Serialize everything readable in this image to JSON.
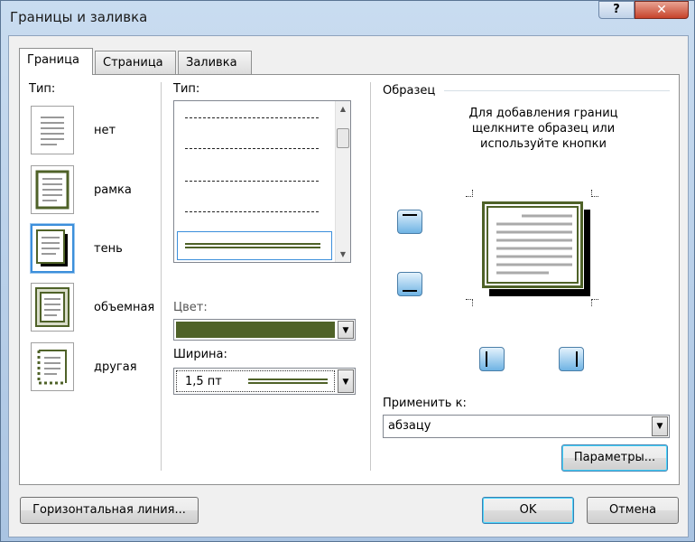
{
  "window": {
    "title": "Границы и заливка",
    "help_label": "?",
    "close_label": "✕"
  },
  "tabs": [
    {
      "label": "Граница",
      "active": true
    },
    {
      "label": "Страница",
      "active": false
    },
    {
      "label": "Заливка",
      "active": false
    }
  ],
  "settings": {
    "label": "Тип:",
    "items": [
      {
        "label": "нет",
        "selected": false
      },
      {
        "label": "рамка",
        "selected": false
      },
      {
        "label": "тень",
        "selected": true
      },
      {
        "label": "объемная",
        "selected": false
      },
      {
        "label": "другая",
        "selected": false
      }
    ]
  },
  "style": {
    "label": "Тип:",
    "color_label": "Цвет:",
    "color_value": "#4f6228",
    "width_label": "Ширина:",
    "width_value": "1,5 пт"
  },
  "preview": {
    "label": "Образец",
    "hint": "Для добавления границ щелкните образец или используйте кнопки",
    "apply_label": "Применить к:",
    "apply_value": "абзацу",
    "options_button": "Параметры..."
  },
  "footer": {
    "horizontal_line_button": "Горизонтальная линия...",
    "ok_button": "OK",
    "cancel_button": "Отмена"
  }
}
